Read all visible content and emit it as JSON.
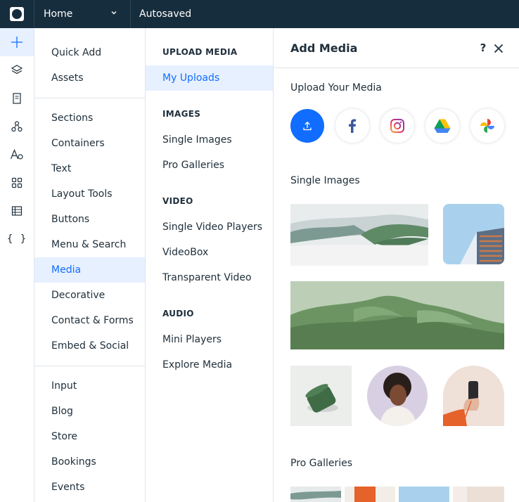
{
  "topbar": {
    "logo_icon": "square-logo-icon",
    "page_name": "Home",
    "status": "Autosaved"
  },
  "rail": {
    "items": [
      {
        "name": "add-elements",
        "icon": "plus-icon",
        "active": true
      },
      {
        "name": "layers",
        "icon": "layers-icon"
      },
      {
        "name": "pages",
        "icon": "page-icon"
      },
      {
        "name": "design",
        "icon": "nodes-icon"
      },
      {
        "name": "theme",
        "icon": "text-style-icon"
      },
      {
        "name": "apps",
        "icon": "apps-grid-icon"
      },
      {
        "name": "cms",
        "icon": "table-icon"
      },
      {
        "name": "code",
        "icon": "braces-icon",
        "label": "{ }"
      }
    ]
  },
  "categories": {
    "items": [
      "Quick Add",
      "Assets",
      "Sections",
      "Containers",
      "Text",
      "Layout Tools",
      "Buttons",
      "Menu & Search",
      "Media",
      "Decorative",
      "Contact & Forms",
      "Embed & Social",
      "Input",
      "Blog",
      "Store",
      "Bookings",
      "Events"
    ],
    "active": "Media"
  },
  "subcategories": {
    "sections": [
      {
        "title": "UPLOAD MEDIA",
        "items": [
          "My Uploads"
        ]
      },
      {
        "title": "IMAGES",
        "items": [
          "Single Images",
          "Pro Galleries"
        ]
      },
      {
        "title": "VIDEO",
        "items": [
          "Single Video Players",
          "VideoBox",
          "Transparent Video"
        ]
      },
      {
        "title": "AUDIO",
        "items": [
          "Mini Players",
          "Explore Media"
        ]
      }
    ],
    "active": "My Uploads"
  },
  "panel": {
    "title": "Add Media",
    "help_label": "?",
    "upload_label": "Upload Your Media",
    "sources": [
      {
        "name": "upload",
        "icon": "upload-icon"
      },
      {
        "name": "facebook",
        "icon": "facebook-icon"
      },
      {
        "name": "instagram",
        "icon": "instagram-icon"
      },
      {
        "name": "google-drive",
        "icon": "google-drive-icon"
      },
      {
        "name": "google-photos",
        "icon": "google-photos-icon"
      }
    ],
    "single_images_label": "Single Images",
    "pro_galleries_label": "Pro Galleries"
  },
  "colors": {
    "topbar": "#162d3d",
    "accent": "#116dff",
    "active_bg": "#e7f0ff",
    "text": "#20303c",
    "divider": "#dfe5eb"
  }
}
